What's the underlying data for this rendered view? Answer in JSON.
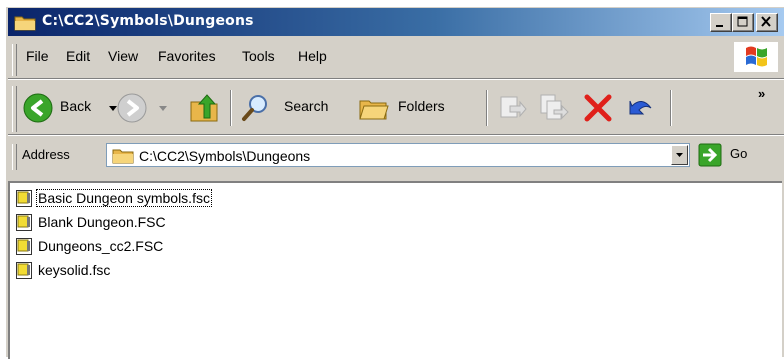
{
  "window": {
    "title": "C:\\CC2\\Symbols\\Dungeons"
  },
  "menu": [
    {
      "label": "File"
    },
    {
      "label": "Edit"
    },
    {
      "label": "View"
    },
    {
      "label": "Favorites"
    },
    {
      "label": "Tools"
    },
    {
      "label": "Help"
    }
  ],
  "toolbar": {
    "back_label": "Back",
    "search_label": "Search",
    "folders_label": "Folders",
    "chevron": "»"
  },
  "address": {
    "label": "Address",
    "value": "C:\\CC2\\Symbols\\Dungeons",
    "go_label": "Go"
  },
  "files": [
    {
      "name": "Basic Dungeon symbols.fsc"
    },
    {
      "name": "Blank Dungeon.FSC"
    },
    {
      "name": "Dungeons_cc2.FSC"
    },
    {
      "name": "keysolid.fsc"
    }
  ],
  "colors": {
    "title_start": "#0a246a",
    "title_end": "#a6caf0",
    "chrome": "#d4d0c8"
  }
}
